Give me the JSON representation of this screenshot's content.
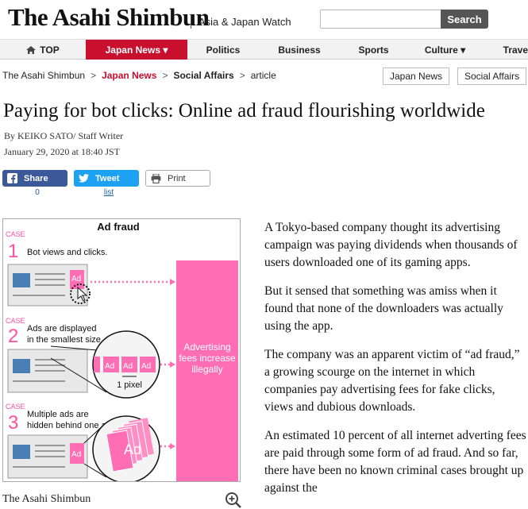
{
  "masthead": {
    "logo": "The Asahi Shimbun",
    "tagline": "Asia & Japan Watch",
    "search_placeholder": "",
    "search_button": "Search"
  },
  "nav": {
    "items": [
      {
        "label": "TOP",
        "icon": "home-icon"
      },
      {
        "label": "Japan News ▾"
      },
      {
        "label": "Politics"
      },
      {
        "label": "Business"
      },
      {
        "label": "Sports"
      },
      {
        "label": "Culture ▾"
      },
      {
        "label": "Trave"
      }
    ],
    "active_color": "#c8102e"
  },
  "breadcrumb": {
    "items": [
      "The Asahi Shimbun",
      "Japan News",
      "Social Affairs",
      "article"
    ],
    "separator": ">"
  },
  "tags": [
    "Japan News",
    "Social Affairs"
  ],
  "article": {
    "headline": "Paying for bot clicks: Online ad fraud flourishing worldwide",
    "byline": "By KEIKO SATO/ Staff Writer",
    "date": "January 29, 2020 at 18:40 JST",
    "paragraphs": [
      "A Tokyo-based company thought its advertising campaign was paying dividends when thousands of users downloaded one of its gaming apps.",
      "But it sensed that something was amiss when it found that none of the downloaders was actually using the app.",
      "The company was an apparent victim of “ad fraud,” a growing scourge on the internet in which companies pay advertising fees for fake clicks, views and dubious downloads.",
      "An estimated 10 percent of all internet adverting fees are paid through some form of ad fraud. And so far, there have been no known criminal cases brought up against the"
    ]
  },
  "share": {
    "facebook": {
      "label": "Share",
      "count": "0",
      "icon": "facebook-icon",
      "color": "#3b5998"
    },
    "twitter": {
      "label": "Tweet",
      "count": "list",
      "icon": "twitter-icon",
      "color": "#1da1f2"
    },
    "print": {
      "label": "Print",
      "icon": "printer-icon"
    }
  },
  "figure": {
    "title": "Ad fraud",
    "case_word": "CASE",
    "cases": [
      {
        "number": "1",
        "text_lines": [
          "Bot views and clicks."
        ]
      },
      {
        "number": "2",
        "text_lines": [
          "Ads are displayed",
          "in the smallest size."
        ]
      },
      {
        "number": "3",
        "text_lines": [
          "Multiple ads are",
          "hidden behind one ad."
        ]
      }
    ],
    "ad_label": "Ad",
    "pixel_label": "1 pixel",
    "result_lines": [
      "Advertising",
      "fees increase",
      "illegally"
    ],
    "caption": "The Asahi Shimbun",
    "accent_color": "#ff6eb4"
  }
}
